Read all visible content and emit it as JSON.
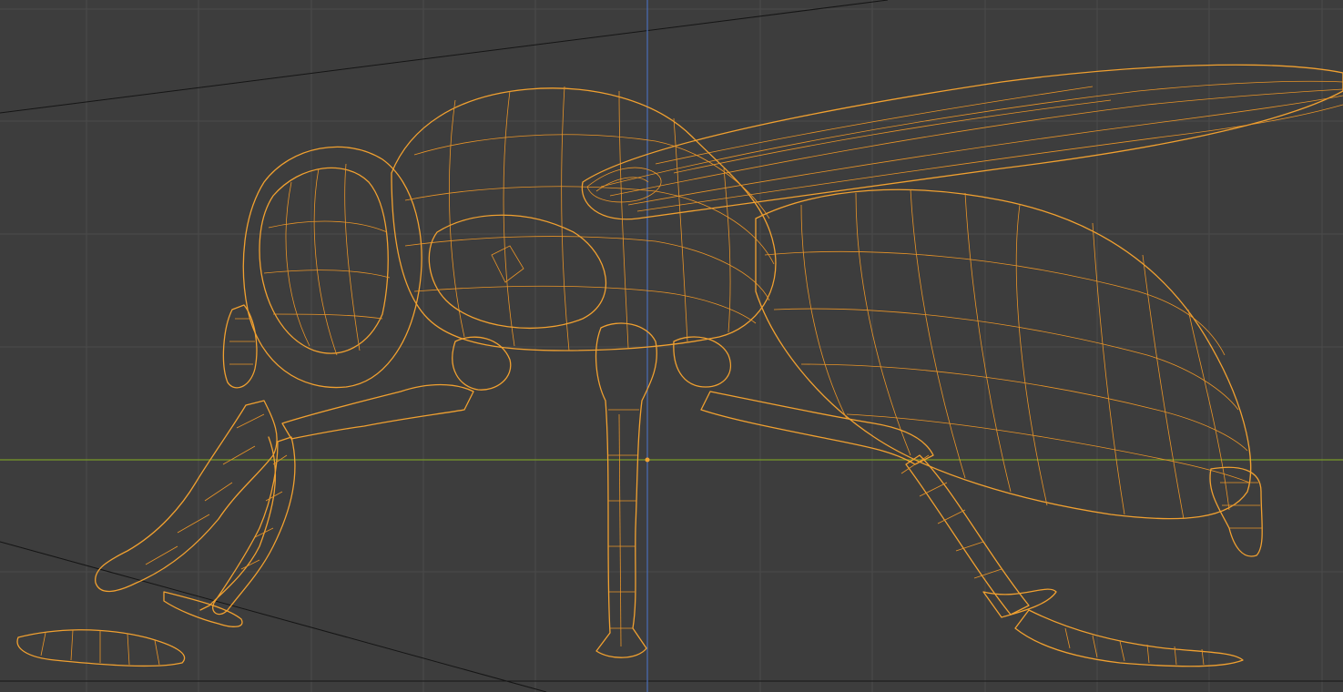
{
  "viewport": {
    "colors": {
      "background": "#3d3d3d",
      "grid": "#4a4a4a",
      "x_axis": "#7a9a28",
      "z_axis": "#4a6fb8",
      "wireframe": "#f0a030"
    },
    "object": {
      "icon": "wireframe-fly-model"
    }
  }
}
